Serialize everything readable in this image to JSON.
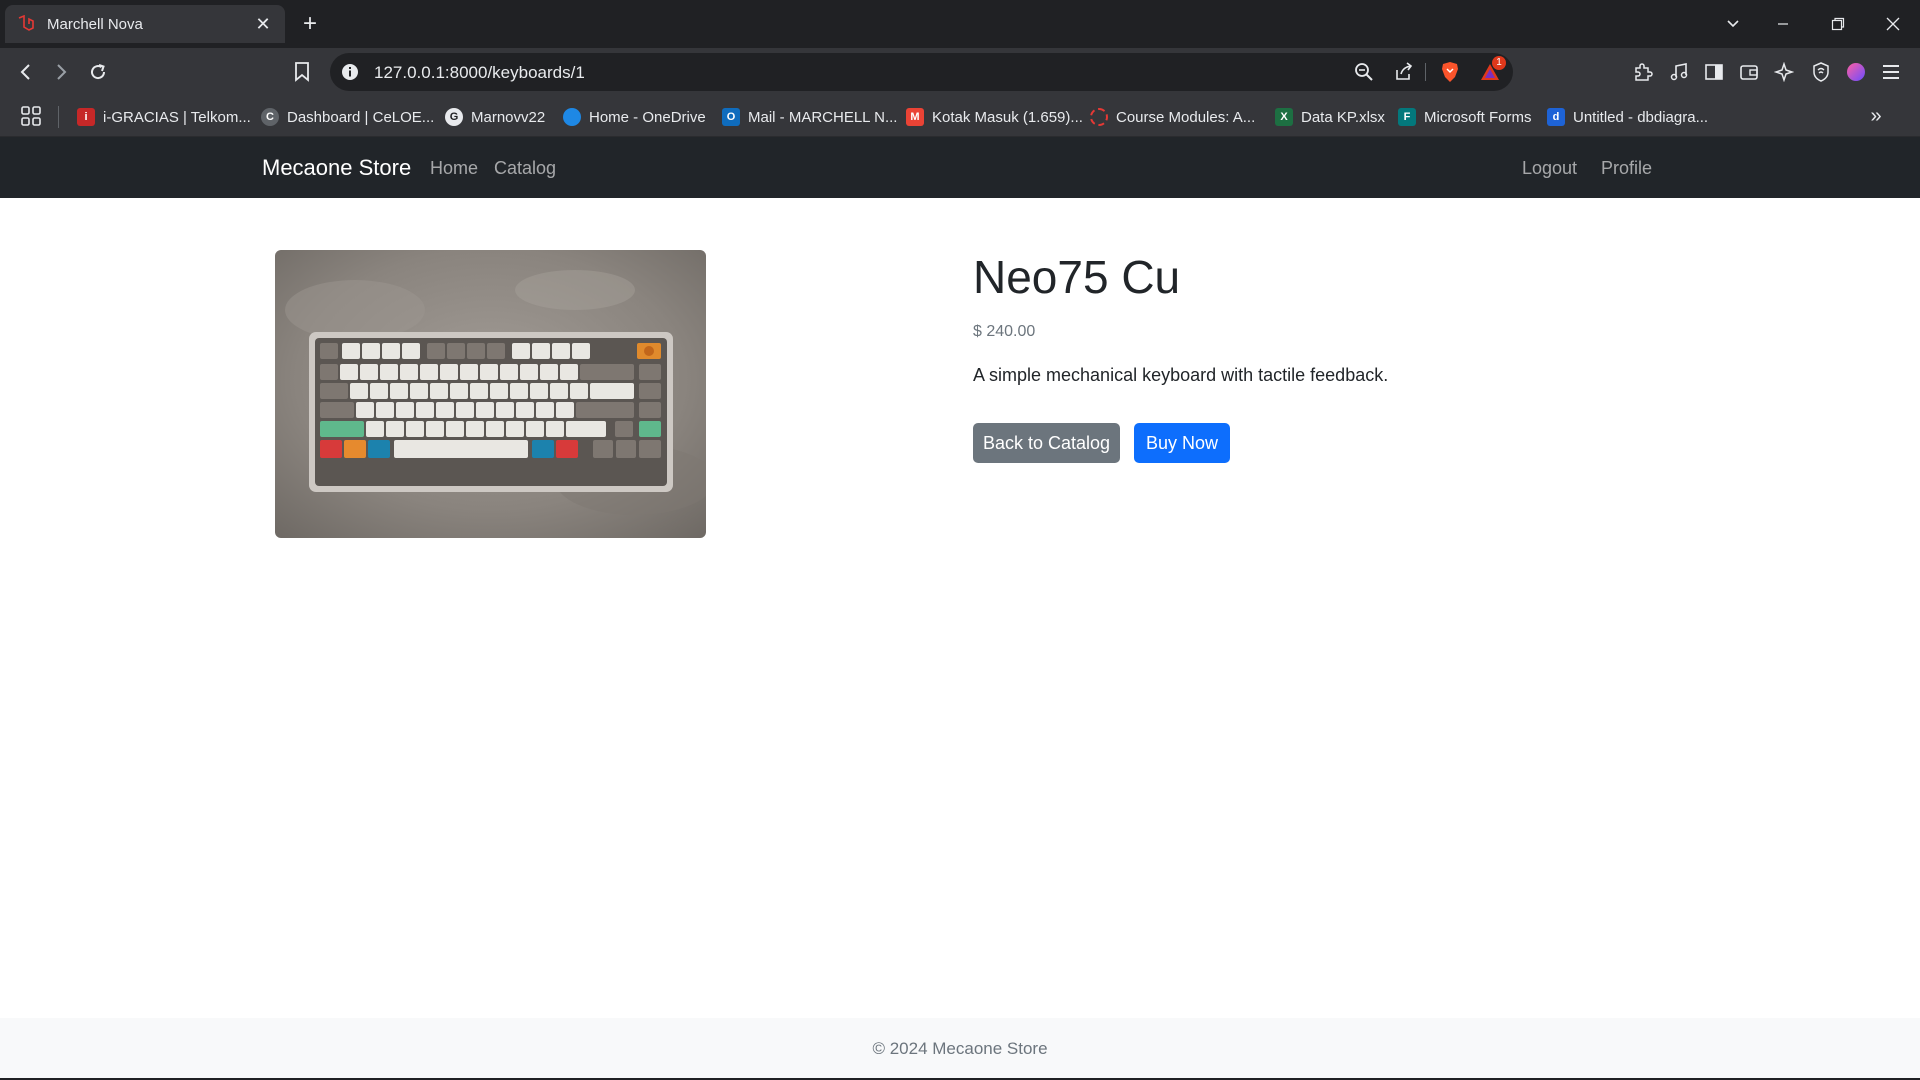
{
  "browser": {
    "tab_title": "Marchell Nova",
    "tab_close": "✕",
    "new_tab": "+",
    "url": "127.0.0.1:8000/keyboards/1",
    "notification_count": "1"
  },
  "bookmarks": [
    {
      "label": "i-GRACIAS | Telkom...",
      "icon": "igracias-icon",
      "color": "#c62828"
    },
    {
      "label": "Dashboard | CeLOE...",
      "icon": "celoe-icon",
      "color": "#5f6368"
    },
    {
      "label": "Marnovv22",
      "icon": "github-icon",
      "color": "#e8eaed"
    },
    {
      "label": "Home - OneDrive",
      "icon": "onedrive-icon",
      "color": "#1e88e5"
    },
    {
      "label": "Mail - MARCHELL N...",
      "icon": "outlook-icon",
      "color": "#0f6cbd"
    },
    {
      "label": "Kotak Masuk (1.659)...",
      "icon": "gmail-icon",
      "color": "#ea4335"
    },
    {
      "label": "Course Modules: A...",
      "icon": "course-icon",
      "color": "#e53935"
    },
    {
      "label": "Data KP.xlsx",
      "icon": "excel-icon",
      "color": "#1d6f42"
    },
    {
      "label": "Microsoft Forms",
      "icon": "forms-icon",
      "color": "#03787c"
    },
    {
      "label": "Untitled - dbdiagra...",
      "icon": "dbdiagram-icon",
      "color": "#1e63d6"
    }
  ],
  "navbar": {
    "brand": "Mecaone Store",
    "links": [
      "Home",
      "Catalog"
    ],
    "right_links": [
      "Logout",
      "Profile"
    ]
  },
  "product": {
    "title": "Neo75 Cu",
    "price": "$ 240.00",
    "description": "A simple mechanical keyboard with tactile feedback.",
    "back_label": "Back to Catalog",
    "buy_label": "Buy Now"
  },
  "footer": {
    "text": "© 2024 Mecaone Store"
  },
  "colors": {
    "navbar_bg": "#212529",
    "primary": "#0d6efd",
    "secondary": "#6c757d",
    "footer_bg": "#f8f9fa"
  }
}
